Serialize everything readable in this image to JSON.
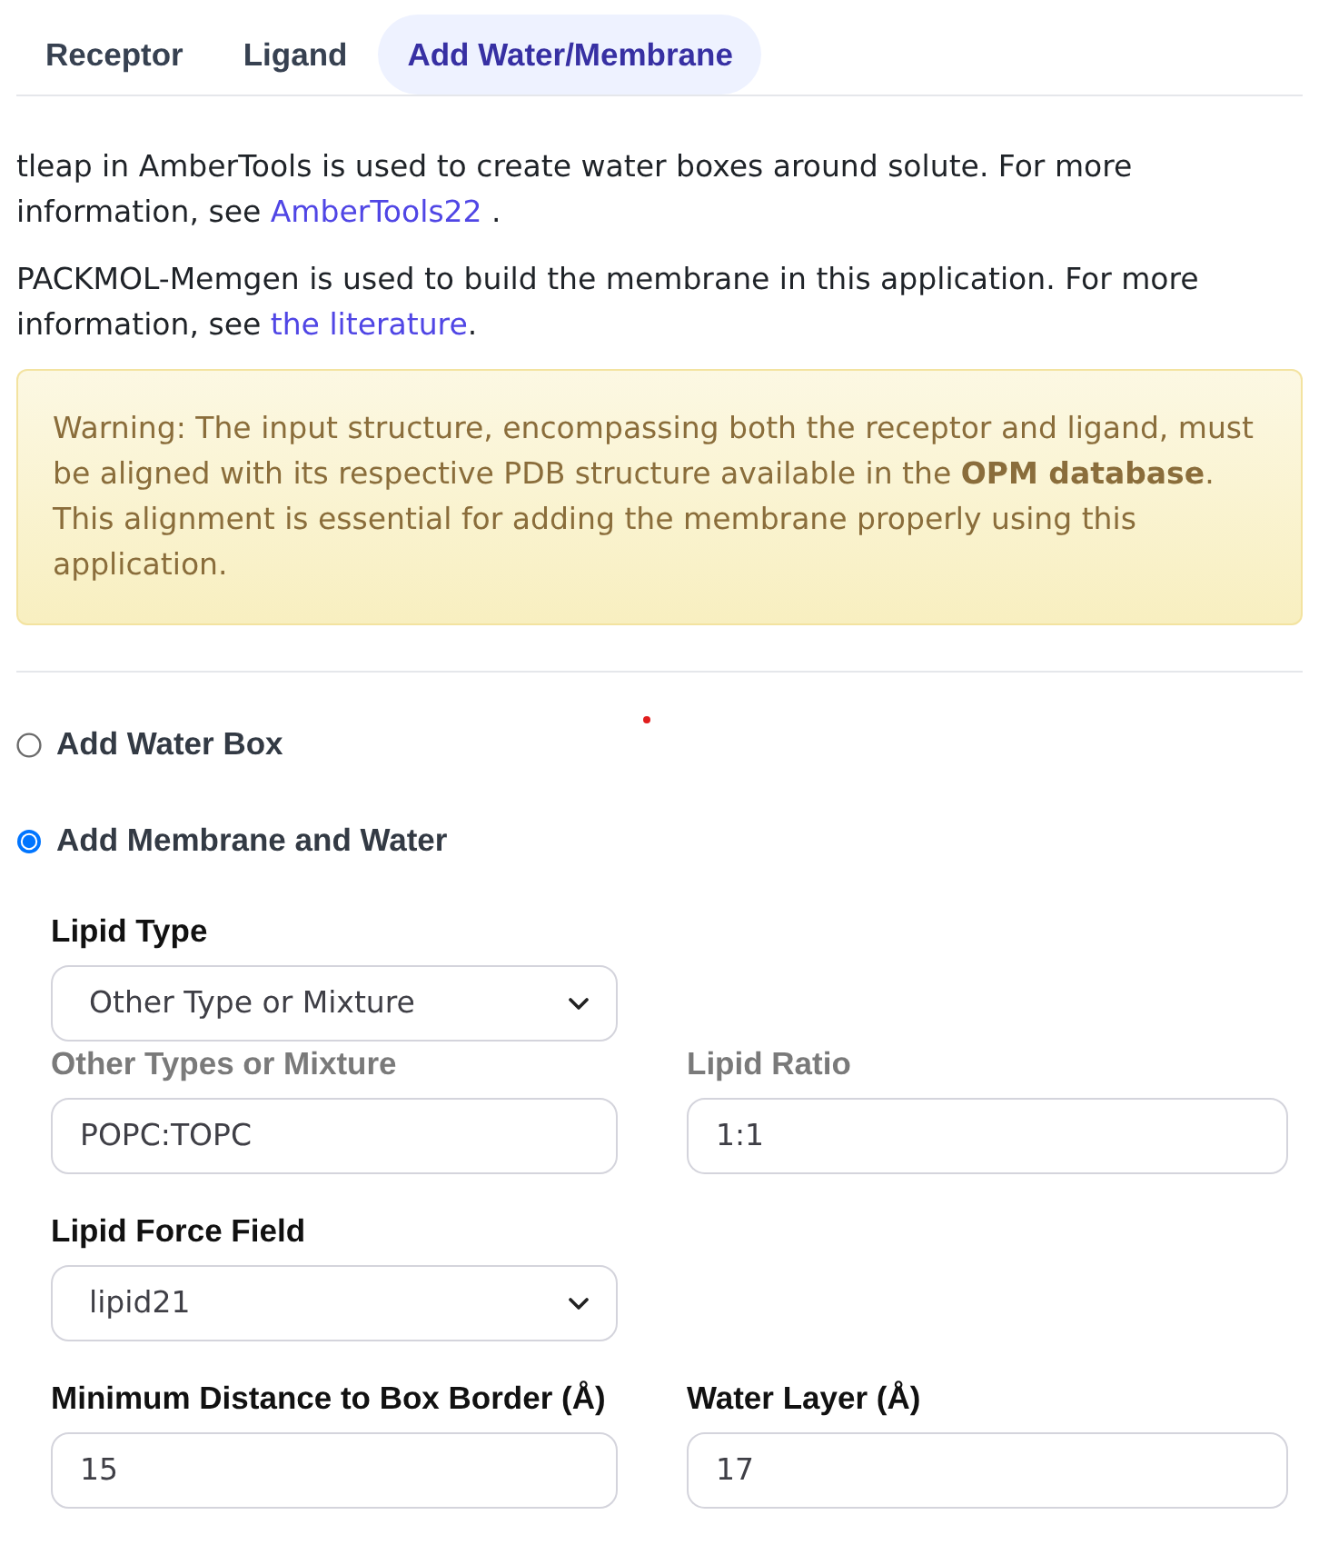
{
  "tabs": [
    {
      "label": "Receptor",
      "selected": false
    },
    {
      "label": "Ligand",
      "selected": false
    },
    {
      "label": "Add Water/Membrane",
      "selected": true
    }
  ],
  "intro": [
    {
      "text": "tleap in AmberTools is used to create water boxes around solute. For more information, see ",
      "link": "AmberTools22",
      "suffix": " ."
    },
    {
      "text": "PACKMOL-Memgen is used to build the membrane in this application. For more information, see ",
      "link": "the literature",
      "suffix": "."
    }
  ],
  "warning": "Warning: The input structure, encompassing both the receptor and ligand, must be aligned with its respective PDB structure available in the **OPM database**. This alignment is essential for adding the membrane properly using this application.",
  "solvation_options": [
    {
      "label": "Add Water Box",
      "selected": false
    },
    {
      "label": "Add Membrane and Water",
      "selected": true
    }
  ],
  "membrane_settings": [
    {
      "muted": false,
      "fields": [
        {
          "kind": "select",
          "label": "Lipid Type",
          "value": "Other Type or Mixture"
        }
      ]
    },
    {
      "muted": true,
      "fields": [
        {
          "kind": "text",
          "label": "Other Types or Mixture",
          "value": "POPC:TOPC"
        },
        {
          "kind": "text",
          "label": "Lipid Ratio",
          "value": "1:1"
        }
      ]
    },
    {
      "muted": false,
      "fields": [
        {
          "kind": "select",
          "label": "Lipid Force Field",
          "value": "lipid21"
        }
      ]
    },
    {
      "muted": false,
      "fields": [
        {
          "kind": "text",
          "label": "Minimum Distance to Box Border (Å)",
          "value": "15"
        },
        {
          "kind": "text",
          "label": "Water Layer (Å)",
          "value": "17"
        }
      ]
    }
  ]
}
